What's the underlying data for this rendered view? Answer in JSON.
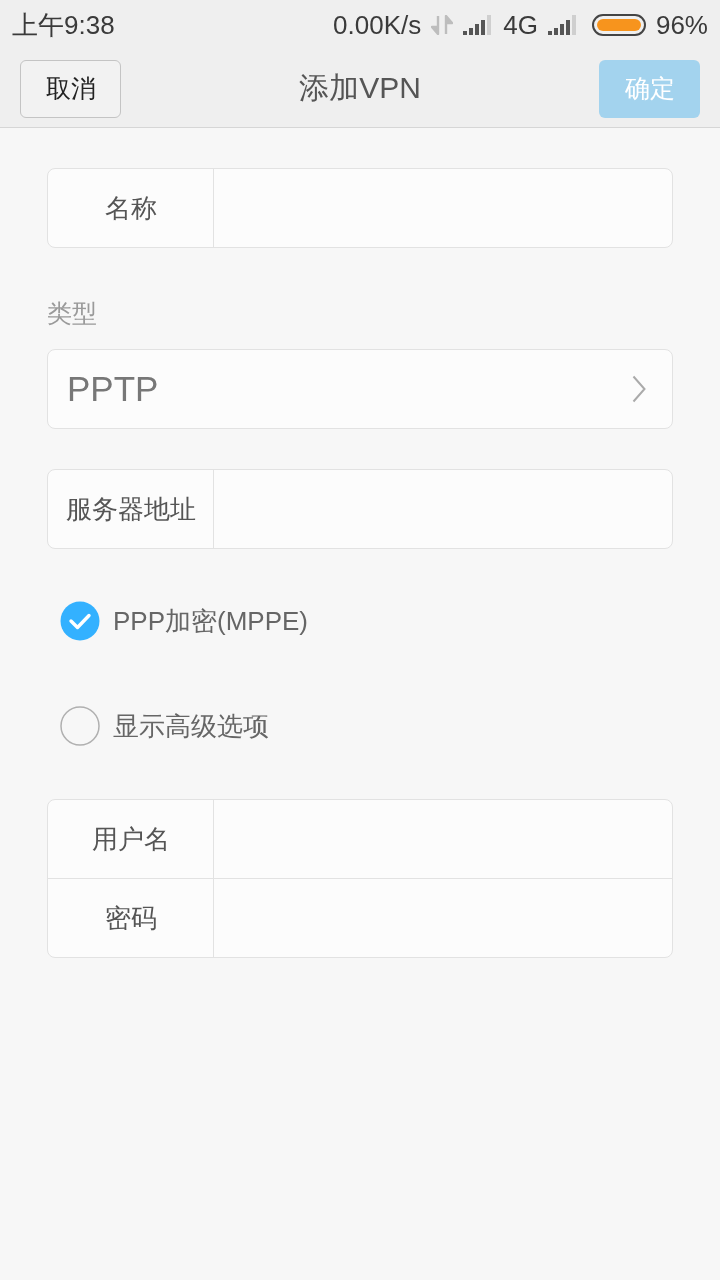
{
  "status_bar": {
    "time": "上午9:38",
    "net_speed": "0.00K/s",
    "network": "4G",
    "battery": "96%"
  },
  "header": {
    "cancel": "取消",
    "title": "添加VPN",
    "confirm": {
      "label": "确定",
      "disabled": true
    }
  },
  "name_field": {
    "label": "名称"
  },
  "type": {
    "label": "类型",
    "value": "PPTP"
  },
  "server_field": {
    "label": "服务器地址"
  },
  "options": [
    {
      "label": "PPP加密(MPPE)",
      "checked": true
    },
    {
      "label": "显示高级选项",
      "checked": false
    }
  ],
  "credentials": [
    {
      "label": "用户名"
    },
    {
      "label": "密码"
    }
  ]
}
